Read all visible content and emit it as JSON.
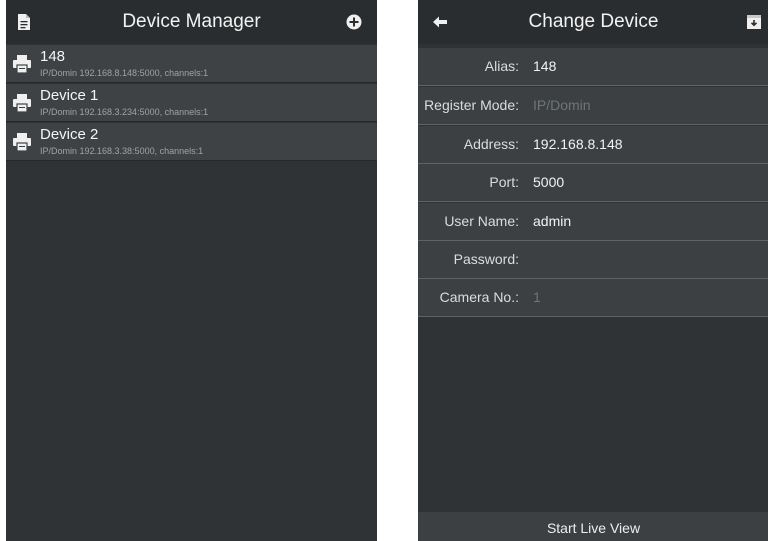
{
  "device_manager": {
    "title": "Device Manager",
    "left_icon": "document-icon",
    "right_icon": "add-circle-icon",
    "devices": [
      {
        "name": "148",
        "detail": "IP/Domin 192.168.8.148:5000, channels:1",
        "icon": "printer-icon"
      },
      {
        "name": "Device 1",
        "detail": "IP/Domin 192.168.3.234:5000, channels:1",
        "icon": "printer-icon"
      },
      {
        "name": "Device 2",
        "detail": "IP/Domin 192.168.3.38:5000, channels:1",
        "icon": "printer-icon"
      }
    ]
  },
  "change_device": {
    "title": "Change Device",
    "left_icon": "back-arrow-icon",
    "right_icon": "save-icon",
    "fields": [
      {
        "label": "Alias:",
        "value": "148"
      },
      {
        "label": "Register Mode:",
        "value": "IP/Domin"
      },
      {
        "label": "Address:",
        "value": "192.168.8.148"
      },
      {
        "label": "Port:",
        "value": "5000"
      },
      {
        "label": "User Name:",
        "value": "admin"
      },
      {
        "label": "Password:",
        "value": ""
      },
      {
        "label": "Camera No.:",
        "value": "1"
      }
    ],
    "start_button": "Start Live View"
  },
  "colors": {
    "background": "#2f3335",
    "titlebar": "#2a2d2f",
    "row": "#3e4244",
    "dim_text": "#6f7477"
  }
}
